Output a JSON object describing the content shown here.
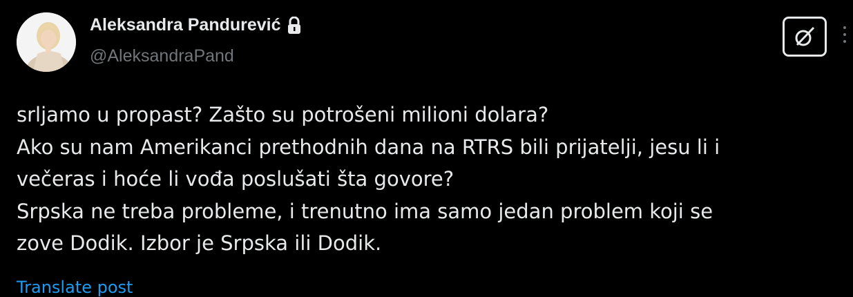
{
  "author": {
    "display_name": "Aleksandra Pandurević",
    "handle": "@AleksandraPand",
    "protected_icon": "lock-icon",
    "avatar_icon": "avatar-photo"
  },
  "actions": {
    "grok_icon": "grok-icon",
    "more_icon": "more-options-icon"
  },
  "tweet": {
    "lines": [
      "srljamo u propast? Zašto su potrošeni milioni dolara?",
      "Ako su nam Amerikanci prethodnih dana na RTRS bili prijatelji, jesu li i",
      "večeras i hoće li vođa poslušati šta  govore?",
      "Srpska ne treba probleme, i trenutno ima samo jedan problem koji se",
      "zove Dodik. Izbor je Srpska ili Dodik."
    ],
    "translate_label": "Translate post"
  },
  "colors": {
    "background": "#000000",
    "text_primary": "#e7e9ea",
    "text_secondary": "#71767b",
    "link": "#1d9bf0"
  }
}
